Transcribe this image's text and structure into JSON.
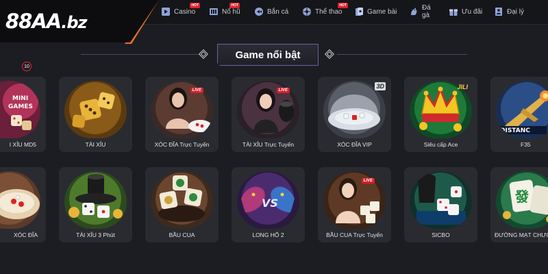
{
  "brand": {
    "logo_main": "88AA",
    "logo_suffix": ".bz"
  },
  "nav": [
    {
      "label": "Casino",
      "icon": "casino-icon",
      "hot": true
    },
    {
      "label": "Nổ hũ",
      "icon": "slot-icon",
      "hot": true
    },
    {
      "label": "Bắn cá",
      "icon": "fish-icon",
      "hot": false
    },
    {
      "label": "Thể thao",
      "icon": "sports-icon",
      "hot": true
    },
    {
      "label": "Game bài",
      "icon": "cards-icon",
      "hot": false
    },
    {
      "label": "Đá gà",
      "icon": "rooster-icon",
      "hot": false
    },
    {
      "label": "Ưu đãi",
      "icon": "gift-icon",
      "hot": false
    },
    {
      "label": "Đại lý",
      "icon": "agent-icon",
      "hot": false
    }
  ],
  "hot_badge": "HOT",
  "section": {
    "title": "Game nổi bật"
  },
  "games_row1": [
    {
      "label": "I XỈU MD5",
      "badge": "10"
    },
    {
      "label": "TÀI XỈU"
    },
    {
      "label": "XÓC ĐĨA Trực Tuyến",
      "badge": "LIVE"
    },
    {
      "label": "TÀI XỈU Trực Tuyến",
      "badge": "LIVE"
    },
    {
      "label": "XÓC ĐĨA VIP",
      "badge": "3D"
    },
    {
      "label": "Siêu cấp Ace",
      "badge": "JILI"
    },
    {
      "label": "F35"
    }
  ],
  "games_row2": [
    {
      "label": "XÓC ĐĨA"
    },
    {
      "label": "TÀI XỈU 3 Phút"
    },
    {
      "label": "BẦU CUA"
    },
    {
      "label": "LONG HỔ 2"
    },
    {
      "label": "BẦU CUA Trực Tuyến",
      "badge": "LIVE"
    },
    {
      "label": "SICBO"
    },
    {
      "label": "ĐƯỜNG MẠT CHƯỢ"
    }
  ],
  "colors": {
    "background": "#1c1d22",
    "card": "#2a2b31",
    "accent_orange": "#e8732c",
    "hot_red": "#e0202c",
    "title_glow": "#6d5fa8"
  }
}
